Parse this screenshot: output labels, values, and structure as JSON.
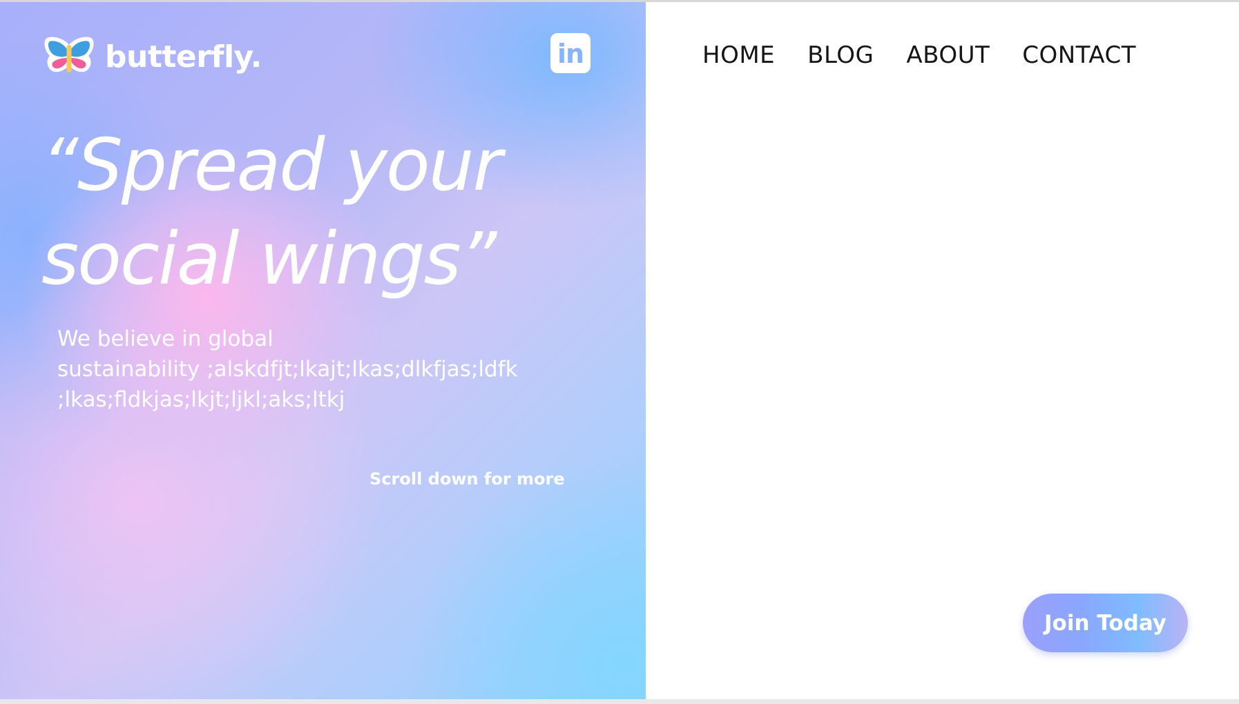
{
  "brand": {
    "name": "butterfly.",
    "logo_icon": "butterfly-logo-icon"
  },
  "social": {
    "linkedin_label": "in",
    "linkedin_icon": "linkedin-icon"
  },
  "nav": {
    "items": [
      {
        "label": "HOME"
      },
      {
        "label": "BLOG"
      },
      {
        "label": "ABOUT"
      },
      {
        "label": "CONTACT"
      }
    ]
  },
  "hero": {
    "headline_line1": "“Spread your",
    "headline_line2": "social wings”",
    "body_line1": "We believe in global",
    "body_line2": "sustainability ;alskdfjt;lkajt;lkas;dlkfjas;ldfk",
    "body_line3": ";lkas;fldkjas;lkjt;ljkl;aks;ltkj",
    "scroll_hint": "Scroll down for more"
  },
  "cta": {
    "join_label": "Join Today"
  },
  "colors": {
    "hero_blue": "#86b4ff",
    "hero_pink": "#ffb8ec",
    "hero_lavender": "#cdc6f6",
    "nav_text": "#151515",
    "button_gradient_start": "#9aa0fb",
    "button_gradient_end": "#b9b3f4"
  }
}
